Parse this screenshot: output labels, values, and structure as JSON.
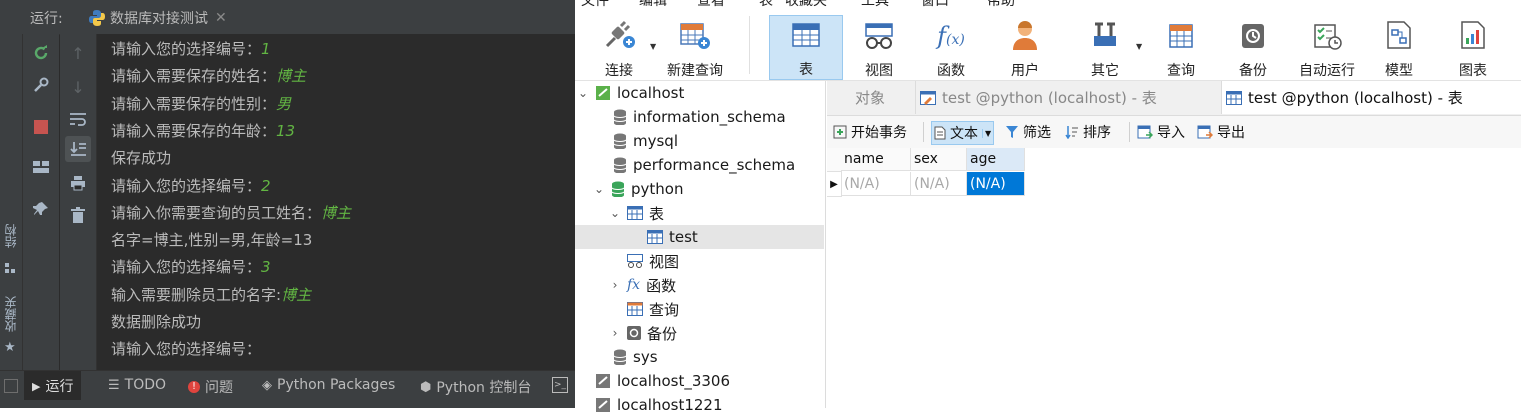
{
  "ide": {
    "run_label": "运行:",
    "run_tab": "数据库对接测试",
    "console_lines": [
      {
        "text": "请输入您的选择编号：",
        "input": "1"
      },
      {
        "text": "请输入需要保存的姓名：",
        "input": "博主"
      },
      {
        "text": "请输入需要保存的性别：",
        "input": "男"
      },
      {
        "text": "请输入需要保存的年龄：",
        "input": "13"
      },
      {
        "text": "保存成功",
        "input": ""
      },
      {
        "text": "请输入您的选择编号：",
        "input": "2"
      },
      {
        "text": "请输入你需要查询的员工姓名：",
        "input": "博主"
      },
      {
        "text": "名字=博主,性别=男,年龄=13",
        "input": ""
      },
      {
        "text": "请输入您的选择编号：",
        "input": "3"
      },
      {
        "text": "输入需要删除员工的名字:",
        "input": "博主"
      },
      {
        "text": "数据删除成功",
        "input": ""
      },
      {
        "text": "请输入您的选择编号：",
        "input": ""
      }
    ],
    "side_labels": {
      "structure": "结构",
      "favorites": "收藏夹"
    },
    "bottom_tabs": {
      "run": "运行",
      "todo": "TODO",
      "problems": "问题",
      "python_packages": "Python Packages",
      "python_console": "Python 控制台"
    }
  },
  "navicat": {
    "menu": [
      "文件",
      "编辑",
      "查看",
      "表",
      "收藏夹",
      "工具",
      "窗口",
      "帮助"
    ],
    "toolbar": {
      "connect": "连接",
      "new_query": "新建查询",
      "table": "表",
      "view": "视图",
      "function": "函数",
      "user": "用户",
      "other": "其它",
      "query": "查询",
      "backup": "备份",
      "auto_run": "自动运行",
      "model": "模型",
      "chart": "图表"
    },
    "tree": {
      "localhost": "localhost",
      "information_schema": "information_schema",
      "mysql": "mysql",
      "performance_schema": "performance_schema",
      "python": "python",
      "tables": "表",
      "test": "test",
      "views": "视图",
      "functions": "函数",
      "queries": "查询",
      "backups": "备份",
      "sys": "sys",
      "localhost_3306": "localhost_3306",
      "localhost1221": "localhost1221"
    },
    "tabs": {
      "objects": "对象",
      "tab1": "test @python (localhost) - 表",
      "tab2": "test @python (localhost) - 表"
    },
    "subbar": {
      "begin_tx": "开始事务",
      "text": "文本",
      "filter": "筛选",
      "sort": "排序",
      "import": "导入",
      "export": "导出"
    },
    "grid": {
      "columns": [
        "name",
        "sex",
        "age"
      ],
      "row": [
        "(N/A)",
        "(N/A)",
        "(N/A)"
      ]
    }
  }
}
